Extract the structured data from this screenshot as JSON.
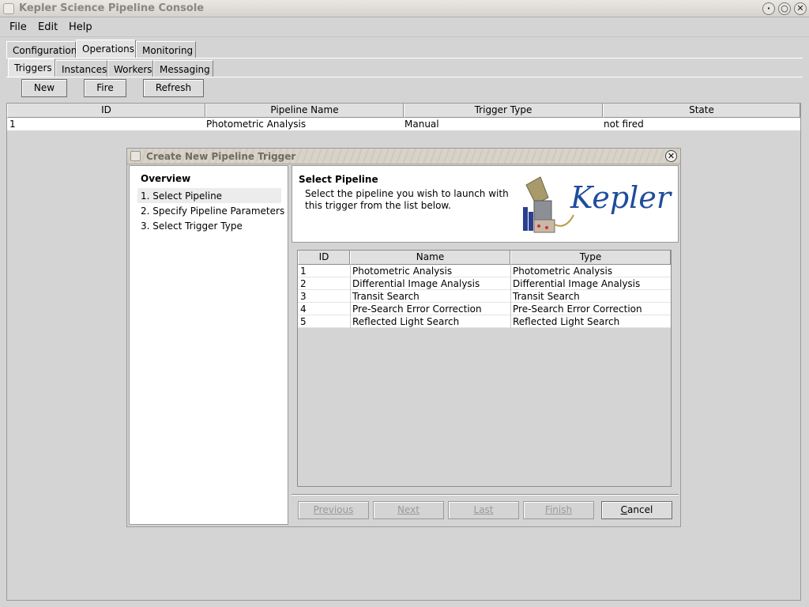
{
  "window": {
    "title": "Kepler Science Pipeline Console"
  },
  "menubar": {
    "file": "File",
    "edit": "Edit",
    "help": "Help"
  },
  "main_tabs": [
    "Configuration",
    "Operations",
    "Monitoring"
  ],
  "sub_tabs": [
    "Triggers",
    "Instances",
    "Workers",
    "Messaging"
  ],
  "toolbar": {
    "new": "New",
    "fire": "Fire",
    "refresh": "Refresh"
  },
  "triggers_table": {
    "headers": [
      "ID",
      "Pipeline Name",
      "Trigger Type",
      "State"
    ],
    "rows": [
      [
        "1",
        "Photometric Analysis",
        "Manual",
        "not fired"
      ]
    ]
  },
  "dialog": {
    "title": "Create New Pipeline Trigger",
    "overview": {
      "heading": "Overview",
      "steps": [
        "1. Select Pipeline",
        "2. Specify Pipeline Parameters",
        "3. Select Trigger Type"
      ]
    },
    "step_header": {
      "title": "Select Pipeline",
      "description_line1": "Select the pipeline you wish to launch with",
      "description_line2": "this trigger from the list below.",
      "logo_text": "Kepler"
    },
    "pipelines_table": {
      "headers": [
        "ID",
        "Name",
        "Type"
      ],
      "rows": [
        [
          "1",
          "Photometric Analysis",
          "Photometric Analysis"
        ],
        [
          "2",
          "Differential Image Analysis",
          "Differential Image Analysis"
        ],
        [
          "3",
          "Transit Search",
          "Transit Search"
        ],
        [
          "4",
          "Pre-Search Error Correction",
          "Pre-Search Error Correction"
        ],
        [
          "5",
          "Reflected Light Search",
          "Reflected Light Search"
        ]
      ]
    },
    "buttons": {
      "previous": {
        "first": "P",
        "rest": "revious"
      },
      "next": {
        "first": "N",
        "rest": "ext"
      },
      "last": {
        "first": "L",
        "rest": "ast"
      },
      "finish": {
        "first": "F",
        "rest": "inish"
      },
      "cancel": {
        "first": "C",
        "rest": "ancel"
      }
    }
  },
  "colors": {
    "background": "#d4d4d4",
    "logo_blue": "#1f4d9c"
  }
}
